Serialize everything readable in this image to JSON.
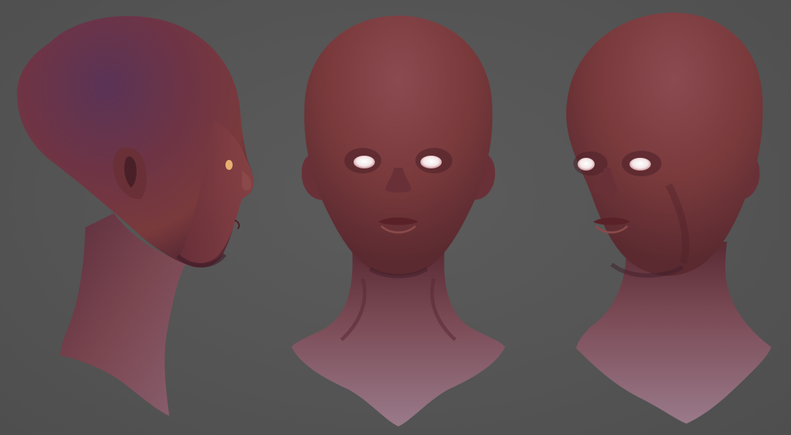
{
  "scene": {
    "background_color": "#555555",
    "skin_base_color": "#7a3a3c",
    "skin_highlight_color": "#9a5a5c",
    "skin_shadow_color": "#3f1d2a",
    "crown_tint_color": "#4c2a4a",
    "eye_glow_color": "#f4e6e8",
    "views": [
      {
        "name": "side-profile",
        "facing": "right"
      },
      {
        "name": "front",
        "facing": "forward"
      },
      {
        "name": "three-quarter",
        "facing": "left"
      }
    ]
  }
}
